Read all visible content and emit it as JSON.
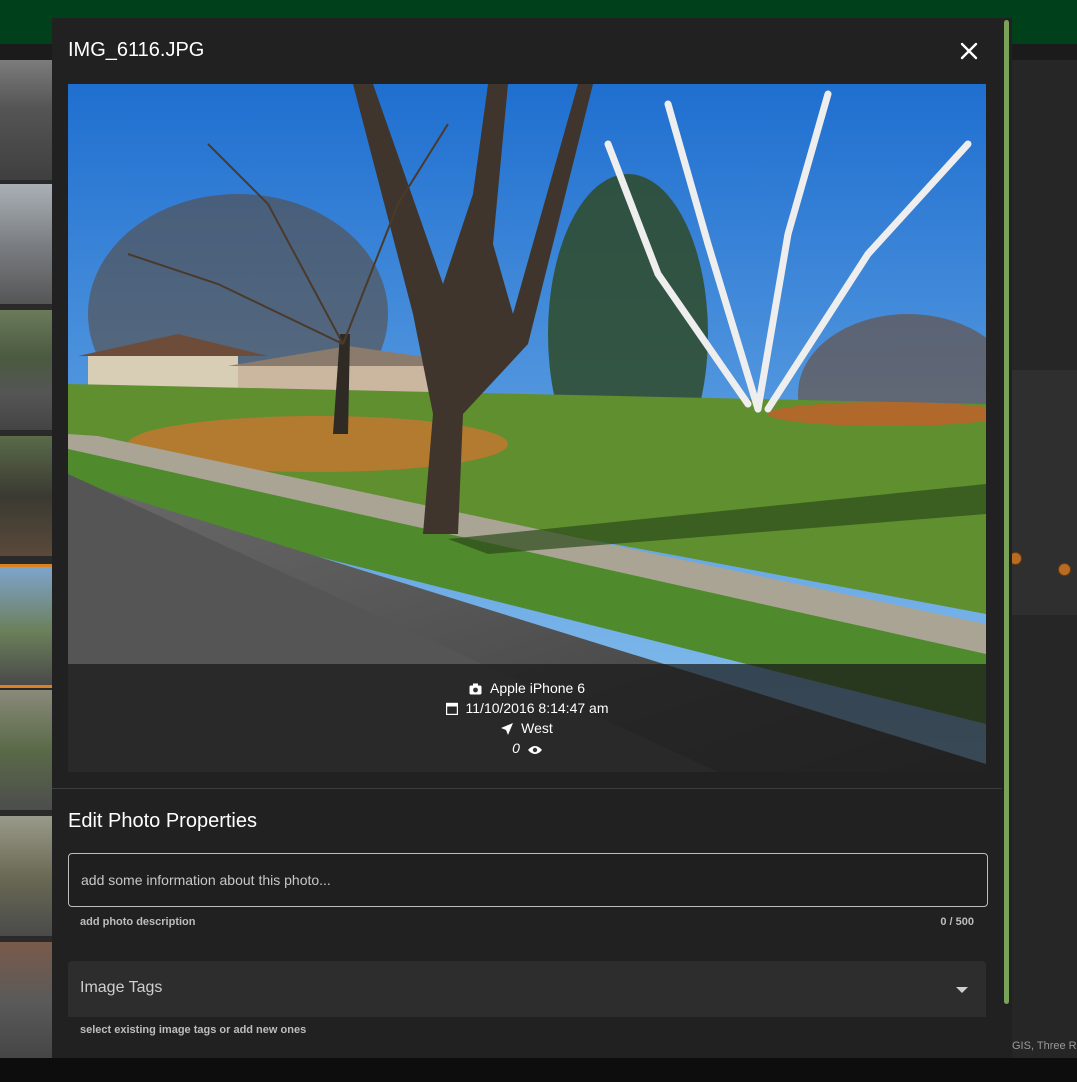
{
  "modal": {
    "title": "IMG_6116.JPG",
    "close_icon": "close-icon"
  },
  "photo": {
    "camera_icon": "camera-icon",
    "camera": "Apple iPhone 6",
    "date_icon": "calendar-icon",
    "datetime": "11/10/2016 8:14:47 am",
    "direction_icon": "navigation-arrow-icon",
    "direction": "West",
    "views": "0",
    "views_icon": "eye-icon"
  },
  "edit": {
    "section_title": "Edit Photo Properties",
    "description_placeholder": "add some information about this photo...",
    "description_value": "",
    "description_helper": "add photo description",
    "description_counter": "0 / 500",
    "tags_label": "Image Tags",
    "tags_icon": "dropdown-arrow-icon",
    "tags_helper": "select existing image tags or add new ones"
  },
  "background": {
    "attribution": "GIS, Three Ri"
  },
  "colors": {
    "topbar": "#00401b",
    "modal_bg": "#212121",
    "scroll_accent": "#7aa35a",
    "map_marker": "#b86b23"
  }
}
